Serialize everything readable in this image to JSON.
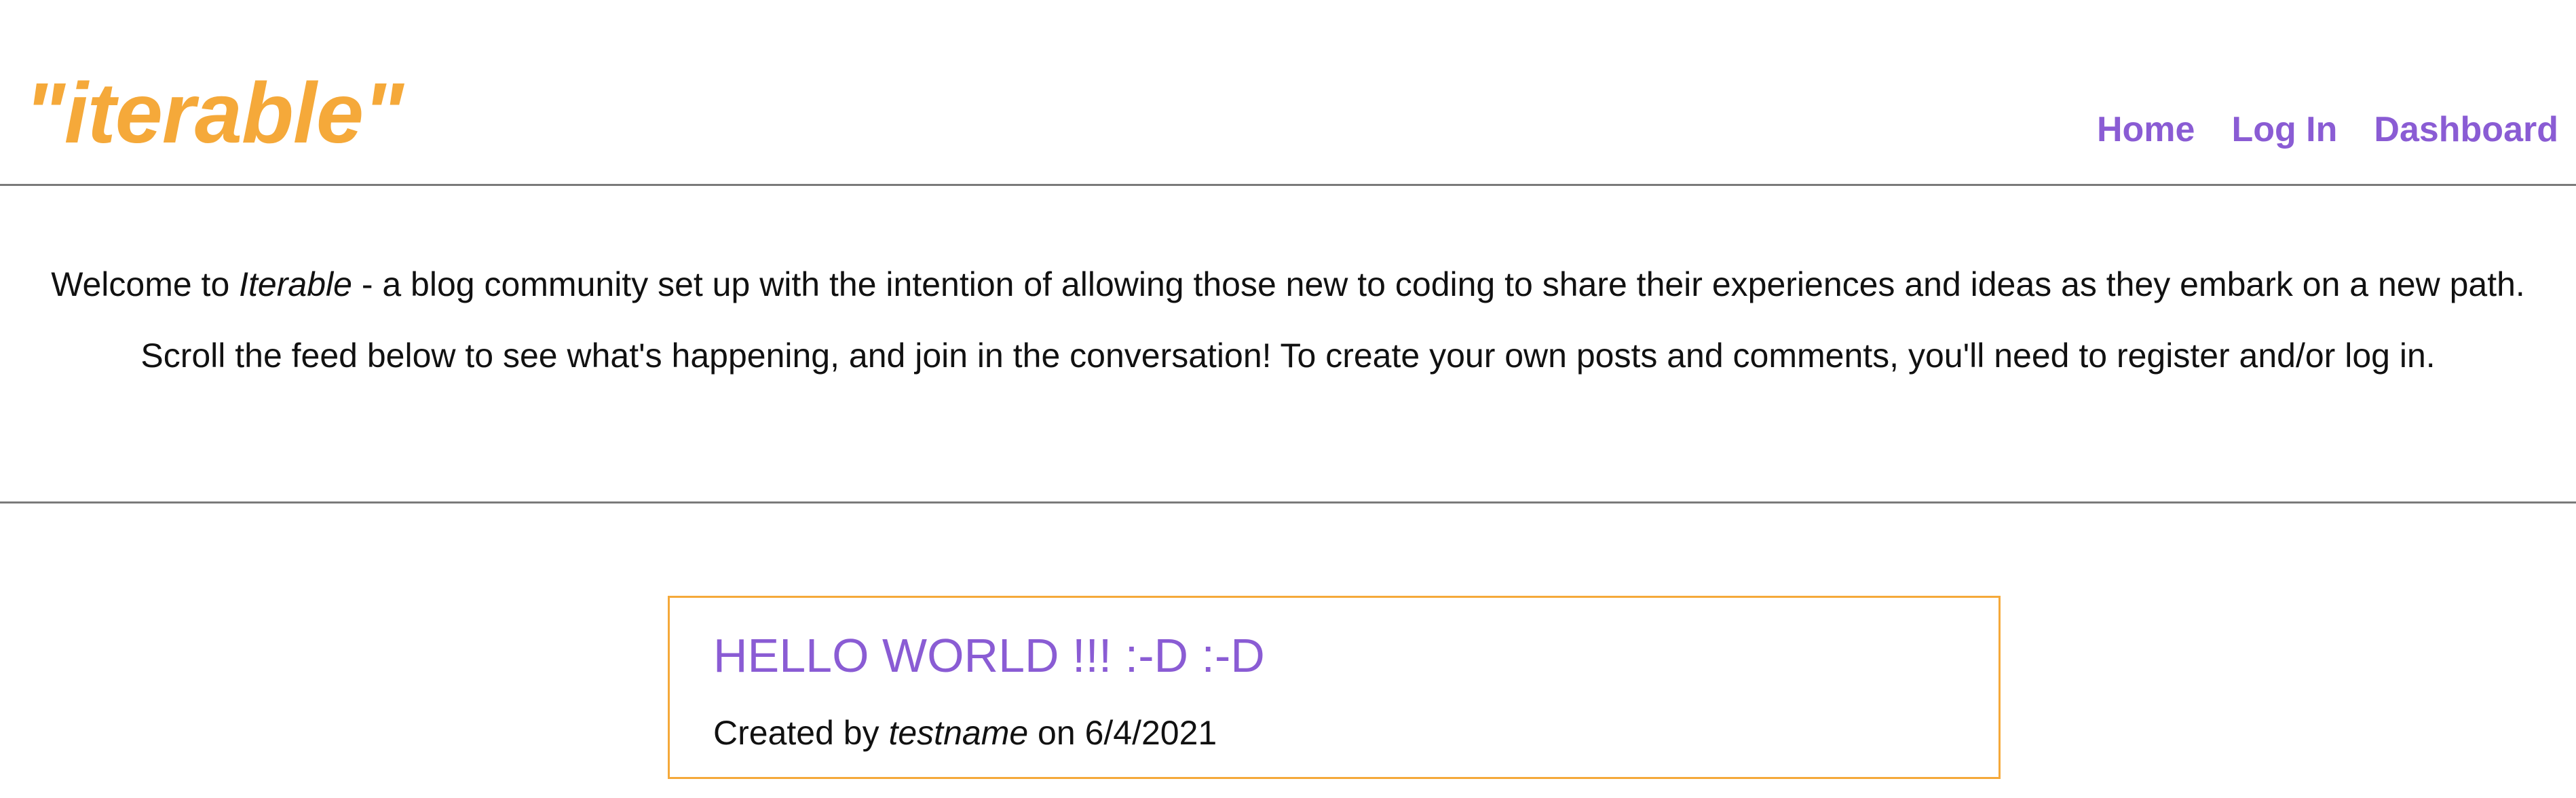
{
  "header": {
    "logo_text": "\"iterable\"",
    "nav": [
      {
        "label": "Home"
      },
      {
        "label": "Log In"
      },
      {
        "label": "Dashboard"
      }
    ]
  },
  "intro": {
    "p1_before": "Welcome to ",
    "p1_em": "Iterable",
    "p1_after": " - a blog community set up with the intention of allowing those new to coding to share their experiences and ideas as they embark on a new path.",
    "p2": "Scroll the feed below to see what's happening, and join in the conversation! To create your own posts and comments, you'll need to register and/or log in."
  },
  "posts": [
    {
      "title": "HELLO WORLD !!! :-D :-D",
      "created_by_prefix": "Created by ",
      "author": "testname",
      "on_text": " on ",
      "date": "6/4/2021"
    }
  ],
  "colors": {
    "logo": "#f5a93a",
    "link": "#8a5cd4",
    "card_border": "#f5a93a",
    "divider": "#7a7a7a"
  }
}
